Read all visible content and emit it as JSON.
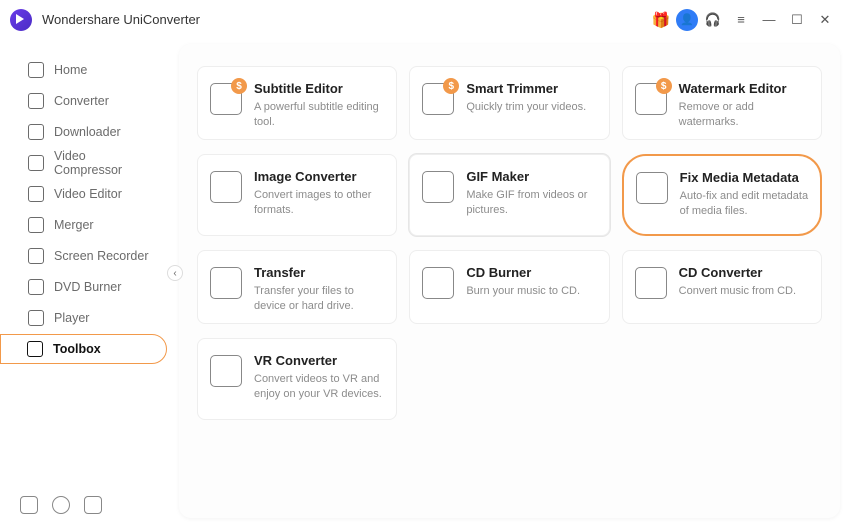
{
  "app": {
    "title": "Wondershare UniConverter"
  },
  "sidebar": {
    "items": [
      {
        "label": "Home"
      },
      {
        "label": "Converter"
      },
      {
        "label": "Downloader"
      },
      {
        "label": "Video Compressor"
      },
      {
        "label": "Video Editor"
      },
      {
        "label": "Merger"
      },
      {
        "label": "Screen Recorder"
      },
      {
        "label": "DVD Burner"
      },
      {
        "label": "Player"
      },
      {
        "label": "Toolbox"
      }
    ]
  },
  "tools": [
    {
      "title": "Subtitle Editor",
      "desc": "A powerful subtitle editing tool.",
      "badge": "$"
    },
    {
      "title": "Smart Trimmer",
      "desc": "Quickly trim your videos.",
      "badge": "$"
    },
    {
      "title": "Watermark Editor",
      "desc": "Remove or add watermarks.",
      "badge": "$"
    },
    {
      "title": "Image Converter",
      "desc": "Convert images to other formats."
    },
    {
      "title": "GIF Maker",
      "desc": "Make GIF from videos or pictures."
    },
    {
      "title": "Fix Media Metadata",
      "desc": "Auto-fix and edit metadata of media files."
    },
    {
      "title": "Transfer",
      "desc": "Transfer your files to device or hard drive."
    },
    {
      "title": "CD Burner",
      "desc": "Burn your music to CD."
    },
    {
      "title": "CD Converter",
      "desc": "Convert music from CD."
    },
    {
      "title": "VR Converter",
      "desc": "Convert videos to VR and enjoy on your VR devices."
    }
  ]
}
